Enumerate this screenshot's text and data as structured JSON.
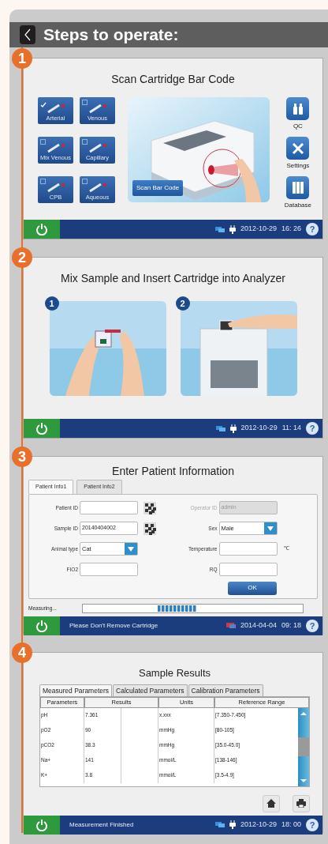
{
  "header": {
    "title": "Steps to operate:"
  },
  "steps": [
    {
      "kind": "scan",
      "number": "1",
      "title": "Scan Cartridge Bar Code",
      "sample_types": [
        {
          "label": "Arterial",
          "checked": true
        },
        {
          "label": "Venous",
          "checked": false
        },
        {
          "label": "Mix Venous",
          "checked": false
        },
        {
          "label": "Capillary",
          "checked": false
        },
        {
          "label": "CPB",
          "checked": false
        },
        {
          "label": "Aqueous",
          "checked": false
        }
      ],
      "scan_button": "Scan Bar Code",
      "side_buttons": [
        {
          "label": "QC",
          "kind": "qc"
        },
        {
          "label": "Settings",
          "kind": "settings"
        },
        {
          "label": "Database",
          "kind": "database"
        }
      ],
      "footer": {
        "date": "2012-10-29",
        "time": "16: 26",
        "help": "?"
      }
    },
    {
      "kind": "mix",
      "number": "2",
      "title": "Mix Sample and Insert Cartridge into Analyzer",
      "panels": [
        {
          "number": "1"
        },
        {
          "number": "2"
        }
      ],
      "footer": {
        "date": "2012-10-29",
        "time": "11: 14",
        "help": "?"
      }
    },
    {
      "kind": "patient",
      "number": "3",
      "title": "Enter Patient Information",
      "tabs": [
        {
          "label": "Patient Info1",
          "selected": true
        },
        {
          "label": "Patient Info2",
          "selected": false
        }
      ],
      "fields": [
        {
          "label": "Patient ID",
          "kind": "text",
          "scan": true,
          "disabled": false
        },
        {
          "label": "Operator ID",
          "kind": "text",
          "value": "admin",
          "scan": false,
          "disabled": true
        },
        {
          "label": "Sample ID",
          "kind": "text",
          "value": "20140404002",
          "scan": true,
          "disabled": false
        },
        {
          "label": "Sex",
          "kind": "select",
          "value": "Male",
          "scan": false,
          "disabled": false
        },
        {
          "label": "Animal type",
          "kind": "select",
          "value": "Cat",
          "scan": false,
          "disabled": false
        },
        {
          "label": "Temperature",
          "kind": "text",
          "unit": "℃",
          "scan": false,
          "disabled": false
        },
        {
          "label": "FIO2",
          "kind": "text",
          "scan": false,
          "disabled": false
        },
        {
          "label": "RQ",
          "kind": "text",
          "scan": false,
          "disabled": false
        }
      ],
      "ok_button": "OK",
      "progress_label": "Measuring...",
      "footer": {
        "status": "Please Don't Remove Cartridge",
        "date": "2014-04-04",
        "time": "09: 18",
        "help": "?"
      }
    },
    {
      "kind": "results",
      "number": "4",
      "title": "Sample Results",
      "tabs": [
        {
          "label": "Measured Parameters",
          "selected": true
        },
        {
          "label": "Calculated Parameters",
          "selected": false
        },
        {
          "label": "Calibration Parameters",
          "selected": false
        }
      ],
      "columns": [
        "Parameters",
        "Results",
        "Units",
        "Reference Range"
      ],
      "rows": [
        [
          "pH",
          "7.361",
          "x.xxx",
          "[7.350-7.450]"
        ],
        [
          "pO2",
          "90",
          "mmHg",
          "[80-105]"
        ],
        [
          "pCO2",
          "38.3",
          "mmHg",
          "[35.0-45.0]"
        ],
        [
          "Na+",
          "141",
          "mmol/L",
          "[138-146]"
        ],
        [
          "K+",
          "3.8",
          "mmol/L",
          "[3.5-4.9]"
        ]
      ],
      "footer": {
        "status": "Measurement Finished",
        "date": "2012-10-29",
        "time": "18: 00",
        "help": "?"
      }
    }
  ]
}
